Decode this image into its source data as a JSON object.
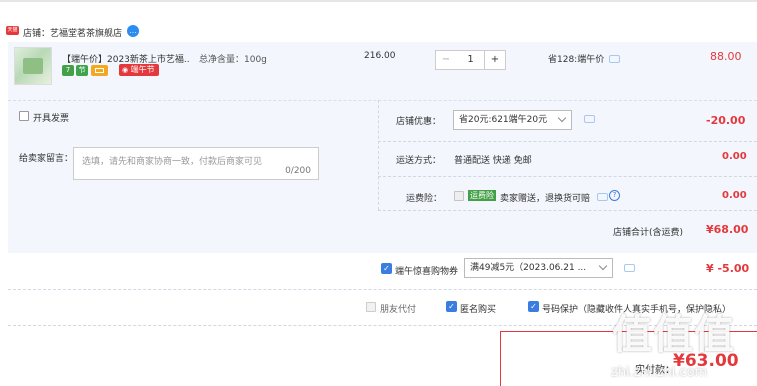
{
  "shop": {
    "badge": "天猫",
    "label": "店铺：艺福堂茗茶旗舰店"
  },
  "item": {
    "title": "【端午价】2023新茶上市艺福...",
    "spec": "总净含量：100g",
    "tags": [
      "7",
      "节"
    ],
    "promo_tag": "端午节",
    "unit_price": "216.00",
    "quantity": "1",
    "minus": "−",
    "plus": "+",
    "saving": "省128:端午价",
    "subtotal": "88.00"
  },
  "invoice": {
    "label": "开具发票"
  },
  "message": {
    "label": "给卖家留言：",
    "placeholder": "选填，请先和商家协商一致，付款后商家可见",
    "counter": "0/200"
  },
  "shop_discount": {
    "label": "店铺优惠：",
    "selected": "省20元:621端午20元",
    "value": "-20.00"
  },
  "delivery": {
    "label": "运送方式：",
    "text": "普通配送 快递 免邮",
    "value": "0.00"
  },
  "insurance": {
    "label": "运费险：",
    "badge": "运费险",
    "text": "卖家赠送，退换货可赔",
    "help": "?",
    "value": "0.00"
  },
  "shop_total": {
    "label": "店铺合计(含运费)",
    "value": "¥68.00"
  },
  "coupon": {
    "label": "端午惊喜购物券",
    "selected": "满49减5元（2023.06.21 ...",
    "value": "¥ -5.00"
  },
  "options": {
    "friend_pay": "朋友代付",
    "anonymous": "匿名购买",
    "privacy": "号码保护（隐藏收件人真实手机号，保护隐私）"
  },
  "payment": {
    "label": "实付款：",
    "value": "¥63.00"
  },
  "watermark": {
    "mark": "值",
    "text": "zhi.zhi.zhi.com"
  },
  "colors": {
    "accent": "#e4393c",
    "panel": "#f3f6fc",
    "check": "#3a7de0",
    "green": "#43a047"
  }
}
